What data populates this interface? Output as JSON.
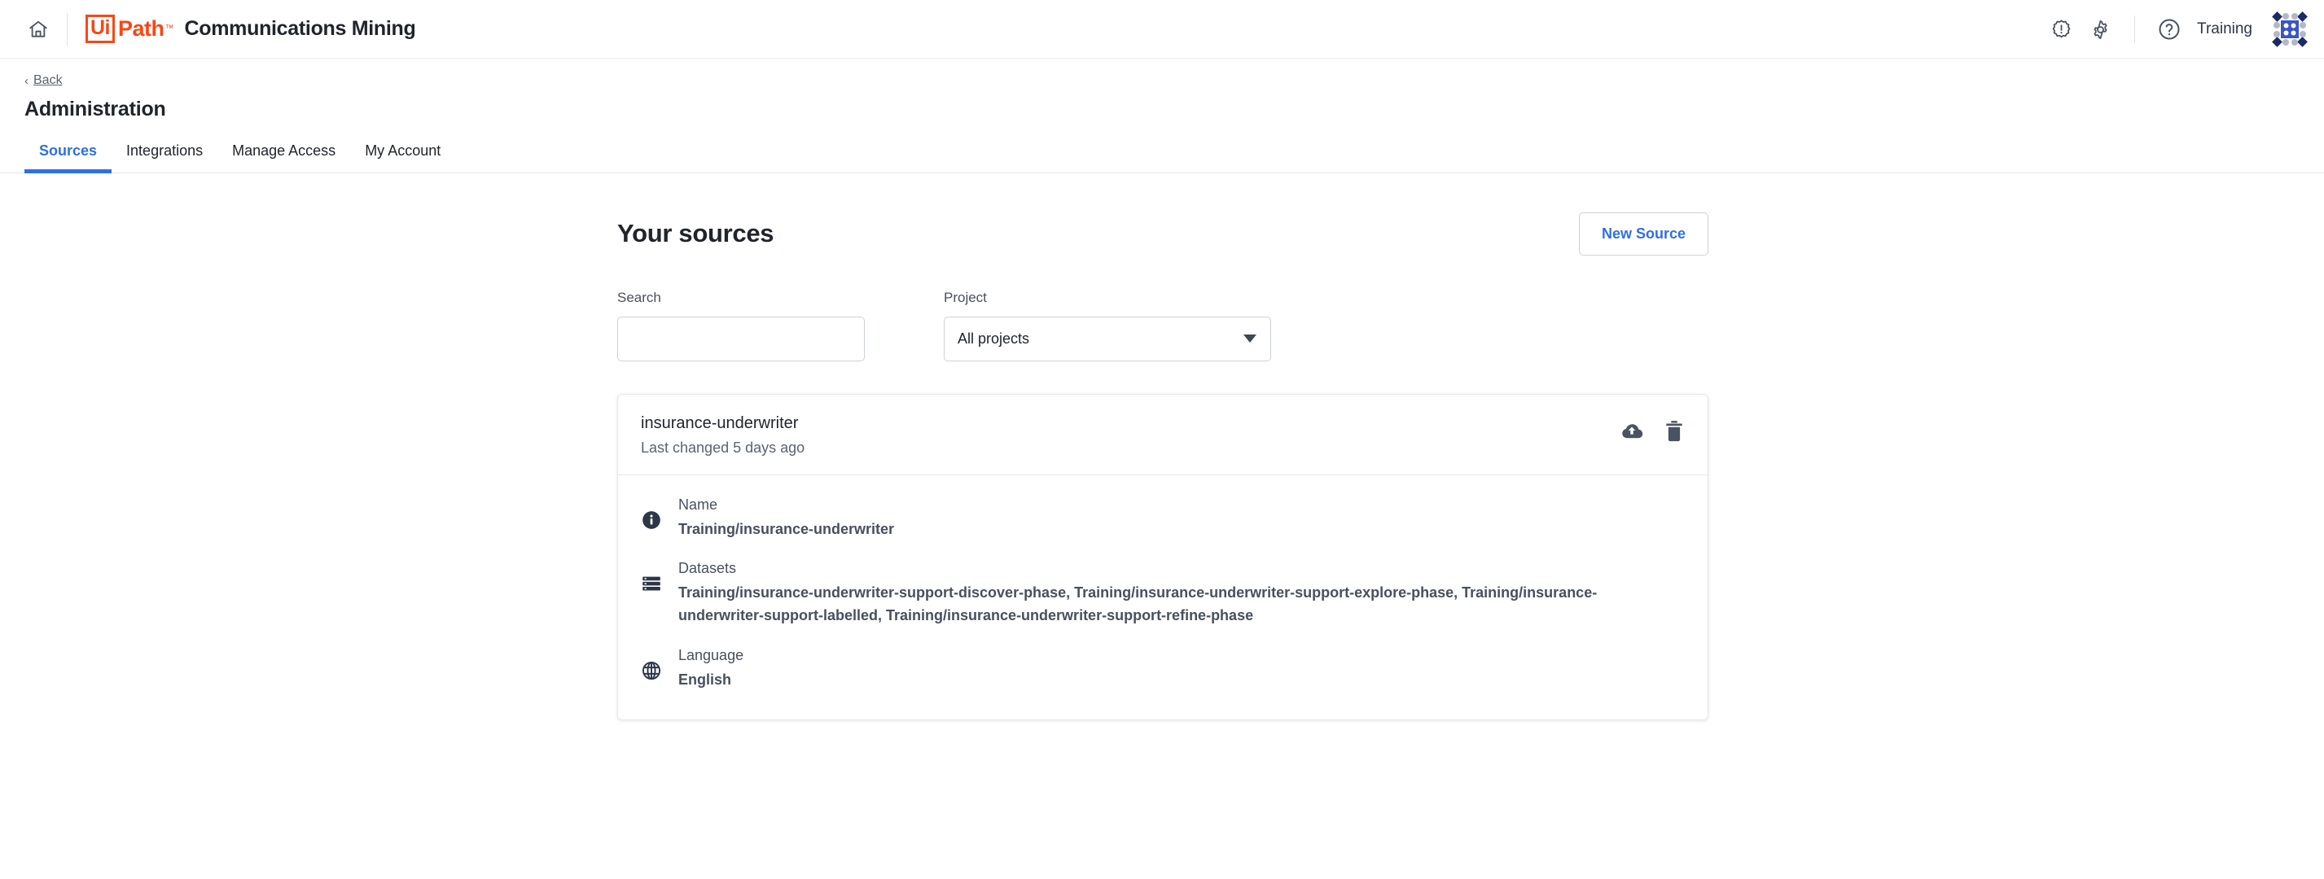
{
  "header": {
    "home_icon": "home-icon",
    "logo": {
      "box_text": "Ui",
      "word": "Path",
      "tm": "™"
    },
    "app_title": "Communications Mining",
    "alert_icon": "alert-badge-icon",
    "settings_icon": "gear-icon",
    "help_icon": "help-circle-icon",
    "training_label": "Training",
    "app_switcher_icon": "app-switcher-icon"
  },
  "page": {
    "back_chevron": "‹",
    "back_label": "Back",
    "title": "Administration"
  },
  "tabs": [
    {
      "label": "Sources",
      "active": true
    },
    {
      "label": "Integrations",
      "active": false
    },
    {
      "label": "Manage Access",
      "active": false
    },
    {
      "label": "My Account",
      "active": false
    }
  ],
  "main": {
    "heading": "Your sources",
    "new_source_label": "New Source",
    "search": {
      "label": "Search",
      "value": "",
      "placeholder": ""
    },
    "project": {
      "label": "Project",
      "selected": "All projects"
    }
  },
  "source_card": {
    "name": "insurance-underwriter",
    "last_changed": "Last changed 5 days ago",
    "upload_icon": "cloud-upload-icon",
    "delete_icon": "trash-icon",
    "details": [
      {
        "icon": "info-circle-icon",
        "label": "Name",
        "value": "Training/insurance-underwriter"
      },
      {
        "icon": "database-icon",
        "label": "Datasets",
        "value": "Training/insurance-underwriter-support-discover-phase, Training/insurance-underwriter-support-explore-phase, Training/insurance-underwriter-support-labelled, Training/insurance-underwriter-support-refine-phase"
      },
      {
        "icon": "globe-icon",
        "label": "Language",
        "value": "English"
      }
    ]
  },
  "colors": {
    "brand_orange": "#fa4616",
    "accent_blue": "#2f6fe4",
    "text_dark": "#20242b",
    "text_muted": "#5a6372",
    "border": "#e4e7ec"
  }
}
